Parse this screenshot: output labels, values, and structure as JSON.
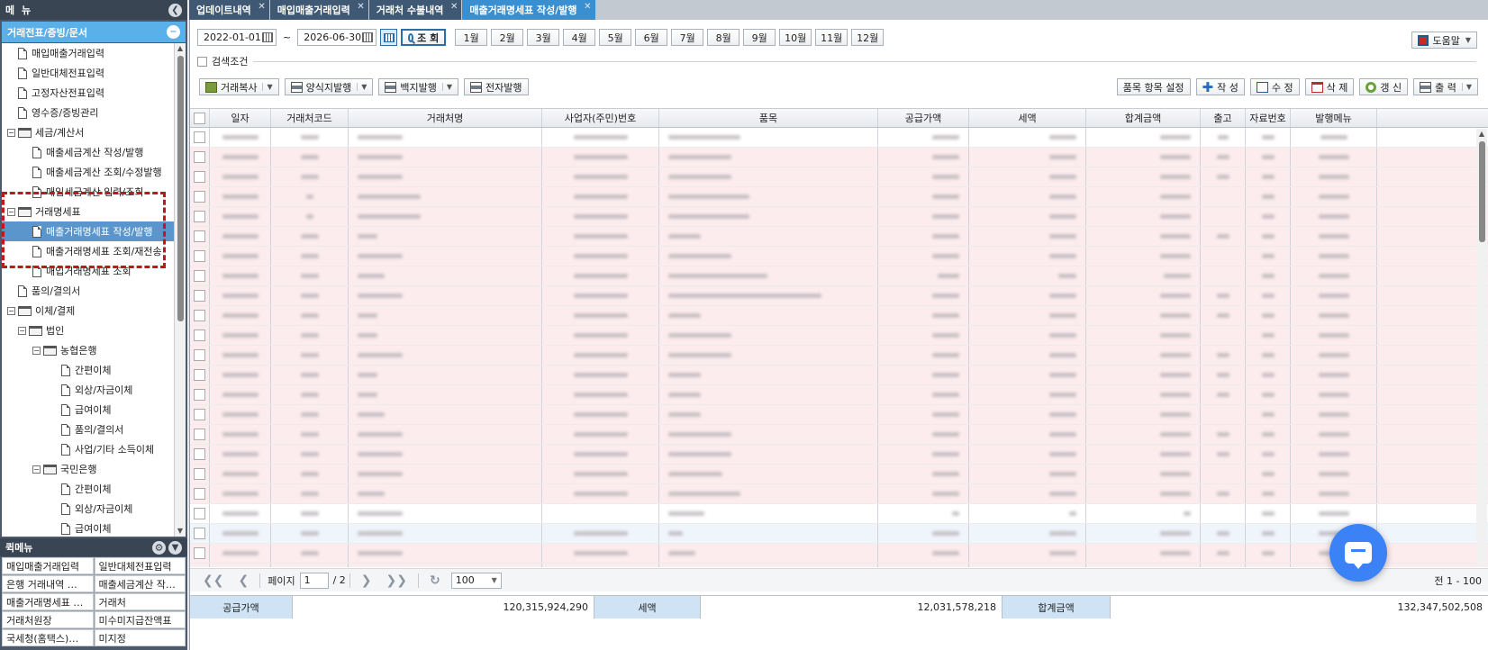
{
  "menu": {
    "title": "메 뉴",
    "collapse_icon": "chevron-left-icon"
  },
  "group": {
    "title": "거래전표/증빙/문서",
    "toggle_icon": "minus-icon"
  },
  "tree": [
    {
      "level": 1,
      "type": "doc",
      "label": "매입매출거래입력"
    },
    {
      "level": 1,
      "type": "doc",
      "label": "일반대체전표입력"
    },
    {
      "level": 1,
      "type": "doc",
      "label": "고정자산전표입력"
    },
    {
      "level": 1,
      "type": "doc",
      "label": "영수증/증빙관리"
    },
    {
      "level": 0,
      "type": "folder",
      "label": "세금/계산서"
    },
    {
      "level": 2,
      "type": "doc",
      "label": "매출세금계산 작성/발행"
    },
    {
      "level": 2,
      "type": "doc",
      "label": "매출세금계산 조회/수정발행"
    },
    {
      "level": 2,
      "type": "doc",
      "label": "매입세금계산 입력/조회"
    },
    {
      "level": 0,
      "type": "folder",
      "label": "거래명세표"
    },
    {
      "level": 2,
      "type": "doc",
      "label": "매출거래명세표 작성/발행",
      "selected": true
    },
    {
      "level": 2,
      "type": "doc",
      "label": "매출거래명세표 조회/재전송"
    },
    {
      "level": 2,
      "type": "doc",
      "label": "매입거래명세표 조회"
    },
    {
      "level": 1,
      "type": "doc",
      "label": "품의/결의서"
    },
    {
      "level": 0,
      "type": "folder",
      "label": "이체/결제"
    },
    {
      "level": 1,
      "type": "folder",
      "label": "법인"
    },
    {
      "level": 2,
      "type": "folder",
      "label": "농협은행"
    },
    {
      "level": 3,
      "type": "doc",
      "label": "간편이체"
    },
    {
      "level": 3,
      "type": "doc",
      "label": "외상/자금이체"
    },
    {
      "level": 3,
      "type": "doc",
      "label": "급여이체"
    },
    {
      "level": 3,
      "type": "doc",
      "label": "품의/결의서"
    },
    {
      "level": 3,
      "type": "doc",
      "label": "사업/기타 소득이체"
    },
    {
      "level": 2,
      "type": "folder",
      "label": "국민은행"
    },
    {
      "level": 3,
      "type": "doc",
      "label": "간편이체"
    },
    {
      "level": 3,
      "type": "doc",
      "label": "외상/자금이체"
    },
    {
      "level": 3,
      "type": "doc",
      "label": "급여이체"
    }
  ],
  "quick_menu": {
    "title": "퀵메뉴",
    "items": [
      "매입매출거래입력",
      "일반대체전표입력",
      "은행 거래내역 …",
      "매출세금계산 작…",
      "매출거래명세표 …",
      "거래처",
      "거래처원장",
      "미수미지급잔액표",
      "국세청(홈택스)…",
      "미지정"
    ]
  },
  "tabs": [
    {
      "label": "업데이트내역",
      "active": false
    },
    {
      "label": "매입매출거래입력",
      "active": false
    },
    {
      "label": "거래처 수불내역",
      "active": false
    },
    {
      "label": "매출거래명세표 작성/발행",
      "active": true
    }
  ],
  "filters": {
    "date_from": "2022-01-01",
    "tilde": "~",
    "date_to": "2026-06-30",
    "search_label": "조 회",
    "months": [
      "1월",
      "2월",
      "3월",
      "4월",
      "5월",
      "6월",
      "7월",
      "8월",
      "9월",
      "10월",
      "11월",
      "12월"
    ],
    "help_label": "도움말",
    "search_condition_label": "검색조건"
  },
  "toolbar": {
    "copy": "거래복사",
    "form_issue": "양식지발행",
    "blank_issue": "백지발행",
    "e_issue": "전자발행",
    "item_settings": "품목 항목 설정",
    "create": "작 성",
    "edit": "수 정",
    "delete": "삭 제",
    "refresh": "갱 신",
    "print": "출 력"
  },
  "grid": {
    "columns": [
      "일자",
      "거래처코드",
      "거래처명",
      "사업자(주민)번호",
      "품목",
      "공급가액",
      "세액",
      "합계금액",
      "출고",
      "자료번호",
      "발행메뉴"
    ],
    "row_colors": [
      "white",
      "pink",
      "pink",
      "pink",
      "pink",
      "pink",
      "pink",
      "pink",
      "pink",
      "pink",
      "pink",
      "pink",
      "pink",
      "pink",
      "pink",
      "pink",
      "pink",
      "pink",
      "pink",
      "white",
      "blue",
      "pink",
      "pink",
      "pink"
    ]
  },
  "pager": {
    "page_label": "페이지",
    "current_page": "1",
    "total_pages": "/ 2",
    "page_size": "100",
    "right_text": "전 1 - 100"
  },
  "summary": {
    "supply_label": "공급가액",
    "supply_value": "120,315,924,290",
    "tax_label": "세액",
    "tax_value": "12,031,578,218",
    "total_label": "합계금액",
    "total_value": "132,347,502,508"
  }
}
